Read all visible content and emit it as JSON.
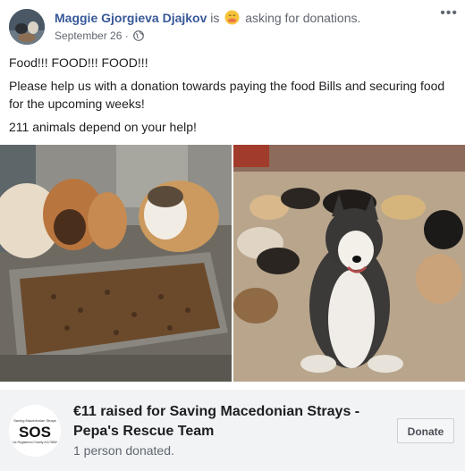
{
  "post": {
    "author": "Maggie Gjorgieva Djajkov",
    "is_text": "is",
    "activity": "asking for donations.",
    "date": "September 26",
    "date_separator": "·",
    "more_label": "•••",
    "body_line1": "Food!!! FOOD!!! FOOD!!!",
    "body_line2": "Please help us with a donation towards paying the food Bills and securing food for the upcoming weeks!",
    "body_line3": "211 animals depend on your help!"
  },
  "fundraiser": {
    "title": "€11 raised for Saving Macedonian Strays - Pepa's Rescue Team",
    "subtitle": "1 person donated.",
    "donate_label": "Donate",
    "logo_text": "SOS",
    "logo_top_text": "Saving Macedonian Strays",
    "logo_bottom_text": "1st Registered Charity #117856*"
  },
  "colors": {
    "link": "#385898",
    "secondary_text": "#606770",
    "fundraiser_bg": "#f2f3f5"
  },
  "icons": [
    "globe-icon",
    "caring-emoji-icon",
    "more-options-icon"
  ]
}
